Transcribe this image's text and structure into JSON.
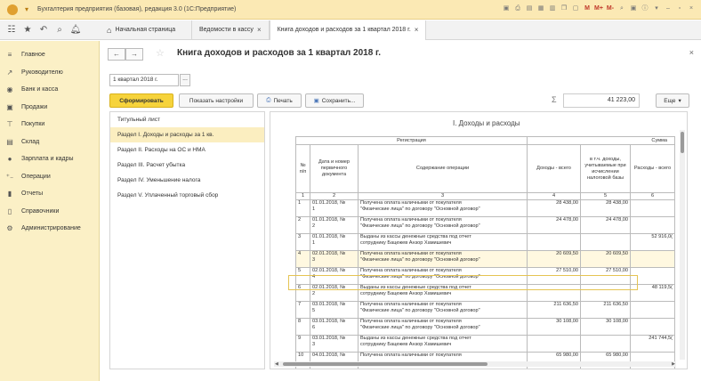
{
  "window": {
    "title": "Бухгалтерия предприятия (базовая), редакция 3.0  (1С:Предприятие)",
    "controls": [
      "M",
      "M+",
      "M-"
    ]
  },
  "tabs": {
    "home": "Начальная страница",
    "tab1": "Ведомости в кассу",
    "tab2": "Книга доходов и расходов за 1 квартал 2018 г."
  },
  "sidebar": {
    "items": [
      {
        "label": "Главное",
        "icon": "menu-icon"
      },
      {
        "label": "Руководителю",
        "icon": "chart-line-icon"
      },
      {
        "label": "Банк и касса",
        "icon": "bank-icon"
      },
      {
        "label": "Продажи",
        "icon": "sales-icon"
      },
      {
        "label": "Покупки",
        "icon": "cart-icon"
      },
      {
        "label": "Склад",
        "icon": "warehouse-icon"
      },
      {
        "label": "Зарплата и кадры",
        "icon": "person-icon"
      },
      {
        "label": "Операции",
        "icon": "operations-icon"
      },
      {
        "label": "Отчеты",
        "icon": "reports-icon"
      },
      {
        "label": "Справочники",
        "icon": "book-icon"
      },
      {
        "label": "Администрирование",
        "icon": "gear-icon"
      }
    ]
  },
  "page": {
    "title": "Книга доходов и расходов за 1 квартал 2018 г.",
    "period": "1 квартал 2018 г.",
    "period_btn": "...",
    "generate": "Сформировать",
    "settings": "Показать настройки",
    "print": "Печать",
    "save": "Сохранить...",
    "sigma": "Σ",
    "sum": "41 223,00",
    "more": "Еще"
  },
  "sections": [
    "Титульный лист",
    "Раздел I. Доходы и расходы за 1 кв.",
    "Раздел II. Расходы на ОС и НМА",
    "Раздел III. Расчет убытка",
    "Раздел IV. Уменьшение налога",
    "Раздел V. Уплаченный торговый сбор"
  ],
  "report": {
    "title": "I. Доходы и расходы",
    "headers": {
      "registration": "Регистрация",
      "sum": "Сумма",
      "no": "№ п/п",
      "date": "Дата и номер первичного документа",
      "content": "Содержание операции",
      "income": "Доходы - всего",
      "income_tax": "в т.ч. доходы, учитываемые при исчислении налоговой базы",
      "expense": "Расходы - всего"
    },
    "col_numbers": [
      "1",
      "2",
      "3",
      "4",
      "5",
      "6"
    ],
    "rows": [
      {
        "n": "1",
        "date": "01.01.2018, №\n1",
        "content": "Получена оплата наличными от покупателя\n\"Физические лица\" по договору \"Основной договор\"",
        "income": "28 438,00",
        "income_tax": "28 438,00",
        "expense": ""
      },
      {
        "n": "2",
        "date": "01.01.2018, №\n2",
        "content": "Получена оплата наличными от покупателя\n\"Физические лица\" по договору \"Основной договор\"",
        "income": "24 478,00",
        "income_tax": "24 478,00",
        "expense": ""
      },
      {
        "n": "3",
        "date": "01.01.2018, №\n1",
        "content": "Выданы из кассы денежные средства под отчет\nсотруднику Бацежев Анзор Хамишевич",
        "income": "",
        "income_tax": "",
        "expense": "52 916,0("
      },
      {
        "n": "4",
        "date": "02.01.2018, №\n3",
        "content": "Получена оплата наличными от покупателя\n\"Физические лица\" по договору \"Основной договор\"",
        "income": "20 609,50",
        "income_tax": "20 609,50",
        "expense": ""
      },
      {
        "n": "5",
        "date": "02.01.2018, №\n4",
        "content": "Получена оплата наличными от покупателя\n\"Физические лица\" по договору \"Основной договор\"",
        "income": "27 510,00",
        "income_tax": "27 510,00",
        "expense": ""
      },
      {
        "n": "6",
        "date": "02.01.2018, №\n2",
        "content": "Выданы из кассы денежные средства под отчет\nсотруднику Бацежев Анзор Хамишевич",
        "income": "",
        "income_tax": "",
        "expense": "48 119,5("
      },
      {
        "n": "7",
        "date": "03.01.2018, №\n5",
        "content": "Получена оплата наличными от покупателя\n\"Физические лица\" по договору \"Основной договор\"",
        "income": "211 636,50",
        "income_tax": "211 636,50",
        "expense": ""
      },
      {
        "n": "8",
        "date": "03.01.2018, №\n6",
        "content": "Получена оплата наличными от покупателя\n\"Физические лица\" по договору \"Основной договор\"",
        "income": "30 108,00",
        "income_tax": "30 108,00",
        "expense": ""
      },
      {
        "n": "9",
        "date": "03.01.2018, №\n3",
        "content": "Выданы из кассы денежные средства под отчет\nсотруднику Бацежев Анзор Хамишевич",
        "income": "",
        "income_tax": "",
        "expense": "241 744,5("
      },
      {
        "n": "10",
        "date": "04.01.2018, №",
        "content": "Получена оплата наличными от покупателя",
        "income": "65 980,00",
        "income_tax": "65 980,00",
        "expense": ""
      }
    ]
  }
}
